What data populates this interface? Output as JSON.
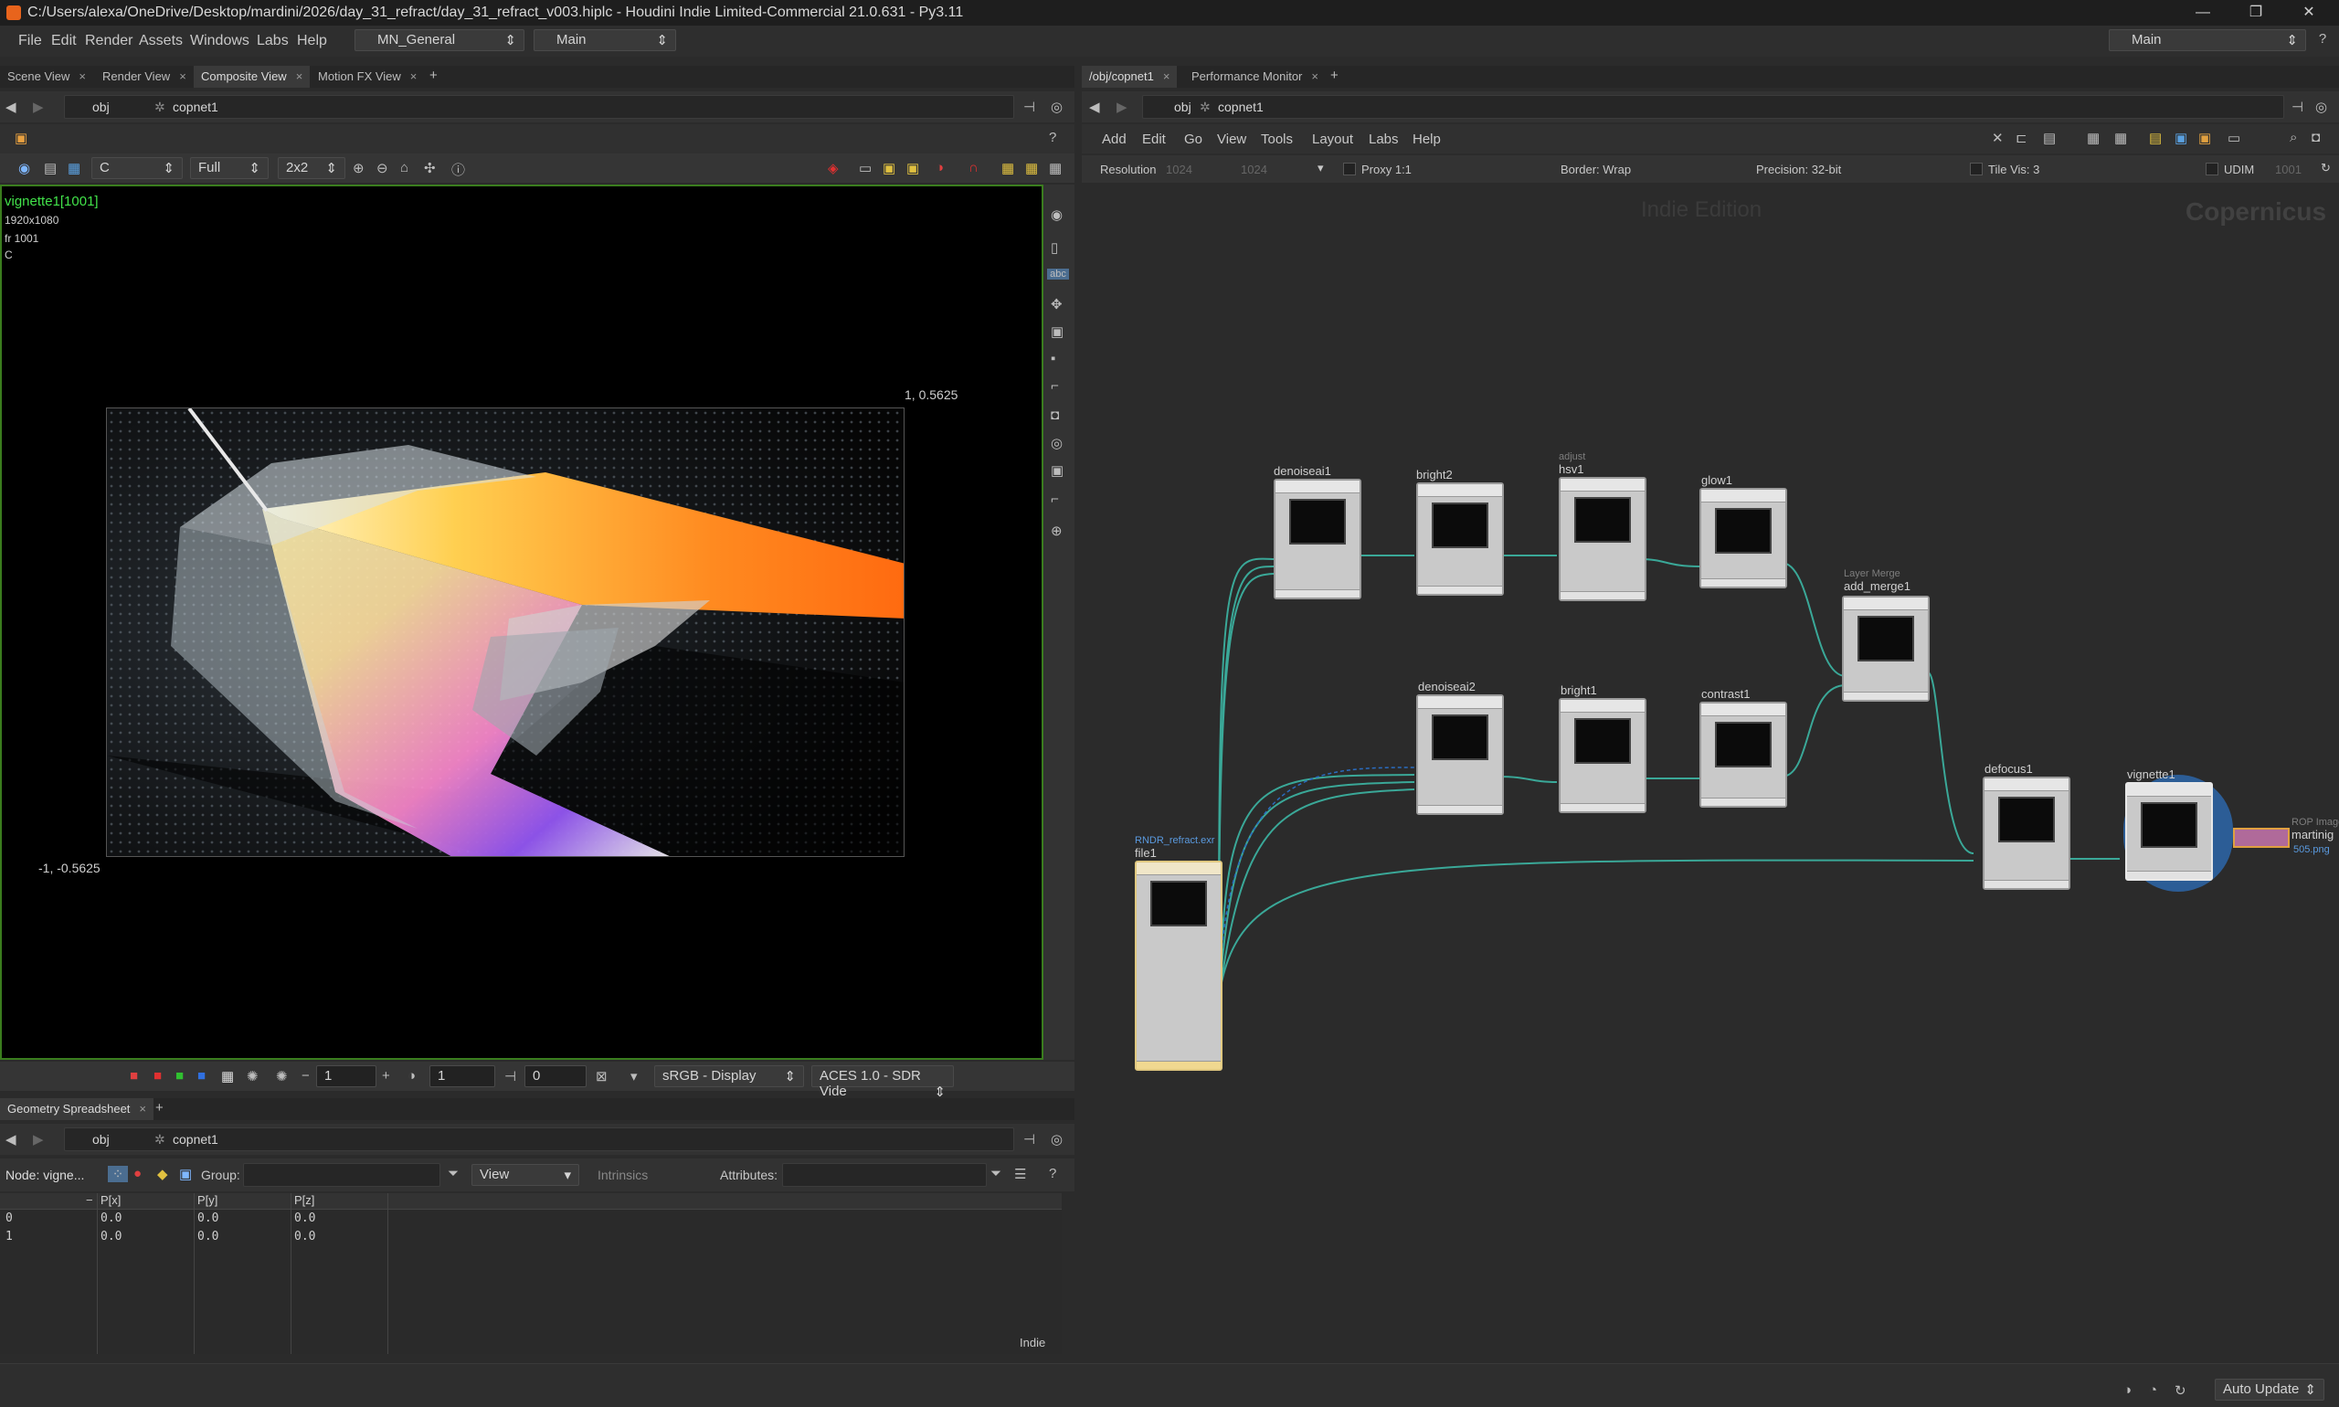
{
  "window": {
    "title": "C:/Users/alexa/OneDrive/Desktop/mardini/2026/day_31_refract/day_31_refract_v003.hiplc - Houdini Indie Limited-Commercial 21.0.631 - Py3.11"
  },
  "menu": {
    "items": [
      "File",
      "Edit",
      "Render",
      "Assets",
      "Windows",
      "Labs",
      "Help"
    ],
    "desktop": "MN_General",
    "context": "Main",
    "right_context": "Main"
  },
  "left_tabs": [
    "Scene View",
    "Render View",
    "Composite View",
    "Motion FX View"
  ],
  "path": {
    "root": "obj",
    "node": "copnet1"
  },
  "viewer_toolbar": {
    "plane": "C",
    "res": "Full",
    "tiles": "2x2"
  },
  "viewport": {
    "node_name": "vignette1[1001]",
    "resolution": "1920x1080",
    "frame": "fr 1001",
    "plane": "C",
    "corner_tr": "1, 0.5625",
    "corner_bl": "-1, -0.5625"
  },
  "viewer_bottom": {
    "exposure": "1",
    "gamma": "1",
    "frame_val": "0",
    "display": "sRGB - Display",
    "view": "ACES 1.0 - SDR Vide"
  },
  "spreadsheet": {
    "tab": "Geometry Spreadsheet",
    "node_label": "Node: vigne...",
    "group_label": "Group:",
    "view_label": "View",
    "intrinsics_label": "Intrinsics",
    "attributes_label": "Attributes:",
    "columns": [
      "P[x]",
      "P[y]",
      "P[z]"
    ],
    "rows": [
      {
        "idx": "0",
        "vals": [
          "0.0",
          "0.0",
          "0.0"
        ]
      },
      {
        "idx": "1",
        "vals": [
          "0.0",
          "0.0",
          "0.0"
        ]
      }
    ],
    "footer": "Indie"
  },
  "right_tabs": [
    "/obj/copnet1",
    "Performance Monitor"
  ],
  "network_menu": [
    "Add",
    "Edit",
    "Go",
    "View",
    "Tools",
    "Layout",
    "Labs",
    "Help"
  ],
  "network_opts": {
    "resolution_label": "Resolution",
    "res_w": "1024",
    "res_h": "1024",
    "proxy": "Proxy 1:1",
    "border": "Border: Wrap",
    "precision": "Precision: 32-bit",
    "tilevis": "Tile Vis: 3",
    "udim": "UDIM",
    "udim_val": "1001"
  },
  "network": {
    "watermark_edition": "Indie Edition",
    "watermark_context": "Copernicus"
  },
  "nodes": [
    {
      "name": "denoiseai1",
      "sub": ""
    },
    {
      "name": "bright2",
      "sub": ""
    },
    {
      "name": "hsv1",
      "sub": "adjust"
    },
    {
      "name": "glow1",
      "sub": ""
    },
    {
      "name": "add_merge1",
      "sub": "Layer Merge"
    },
    {
      "name": "denoiseai2",
      "sub": ""
    },
    {
      "name": "bright1",
      "sub": ""
    },
    {
      "name": "contrast1",
      "sub": ""
    },
    {
      "name": "defocus1",
      "sub": ""
    },
    {
      "name": "vignette1",
      "sub": ""
    },
    {
      "name": "file1",
      "sub": "RNDR_refract.exr"
    },
    {
      "name": "martinig",
      "sub": "ROP Image"
    }
  ],
  "rop_file": "505.png",
  "status": {
    "auto_update": "Auto Update"
  }
}
